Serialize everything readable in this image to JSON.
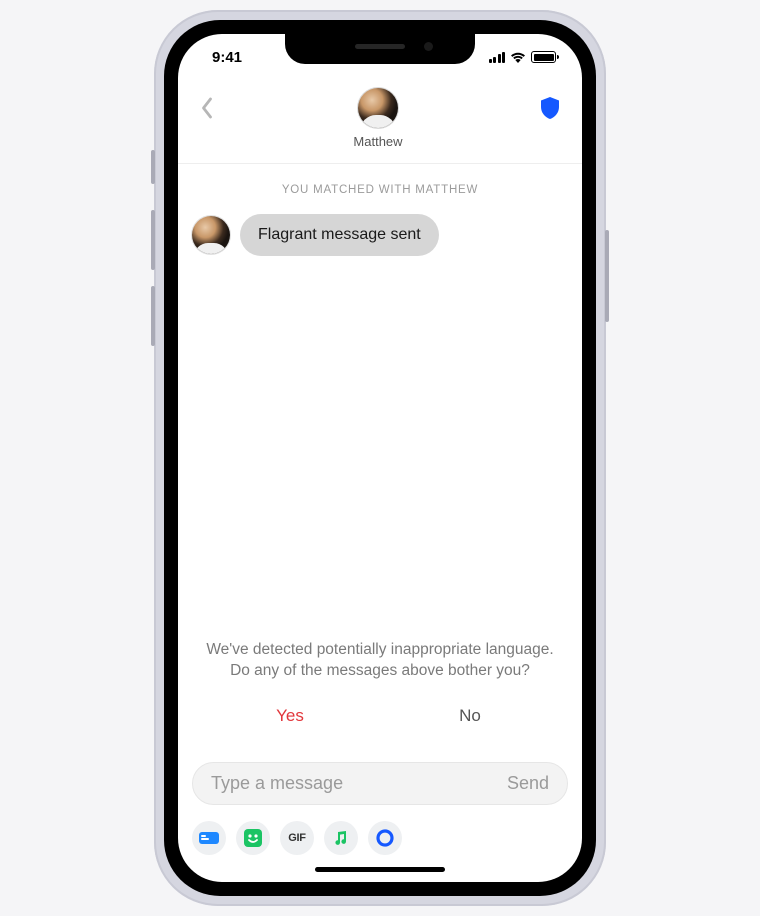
{
  "status": {
    "time": "9:41"
  },
  "header": {
    "name": "Matthew"
  },
  "matchBanner": "YOU MATCHED WITH MATTHEW",
  "messages": [
    {
      "text": "Flagrant message sent"
    }
  ],
  "prompt": {
    "line1": "We've detected potentially inappropriate language.",
    "line2": "Do any of the messages above bother you?",
    "yes": "Yes",
    "no": "No"
  },
  "composer": {
    "placeholder": "Type a message",
    "send": "Send"
  },
  "toolbar": {
    "gif": "GIF"
  }
}
